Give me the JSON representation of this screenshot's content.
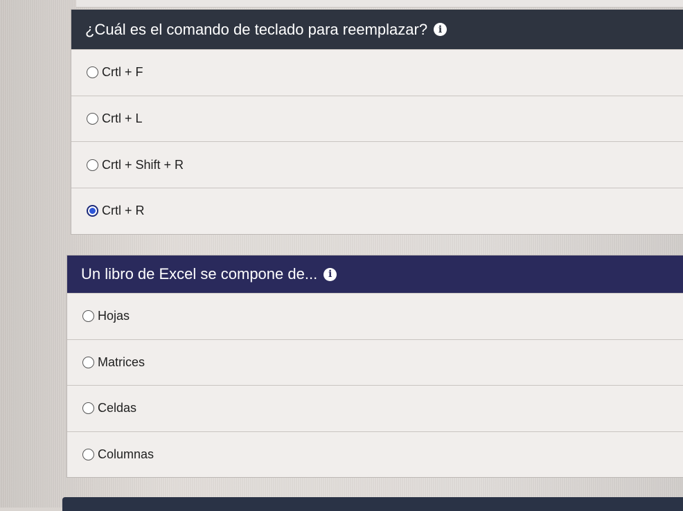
{
  "questions": [
    {
      "text": "¿Cuál es el comando de teclado para reemplazar?",
      "info_icon": "info-icon",
      "options": [
        {
          "label": "Crtl + F",
          "selected": false
        },
        {
          "label": "Crtl + L",
          "selected": false
        },
        {
          "label": "Crtl + Shift + R",
          "selected": false
        },
        {
          "label": "Crtl + R",
          "selected": true
        }
      ]
    },
    {
      "text": "Un libro de Excel se compone de...",
      "info_icon": "info-icon",
      "options": [
        {
          "label": "Hojas",
          "selected": false
        },
        {
          "label": "Matrices",
          "selected": false
        },
        {
          "label": "Celdas",
          "selected": false
        },
        {
          "label": "Columnas",
          "selected": false
        }
      ]
    }
  ],
  "colors": {
    "header_dark": "#2e3440",
    "header_navy": "#2a2a5c",
    "radio_selected": "#2f57d8"
  }
}
